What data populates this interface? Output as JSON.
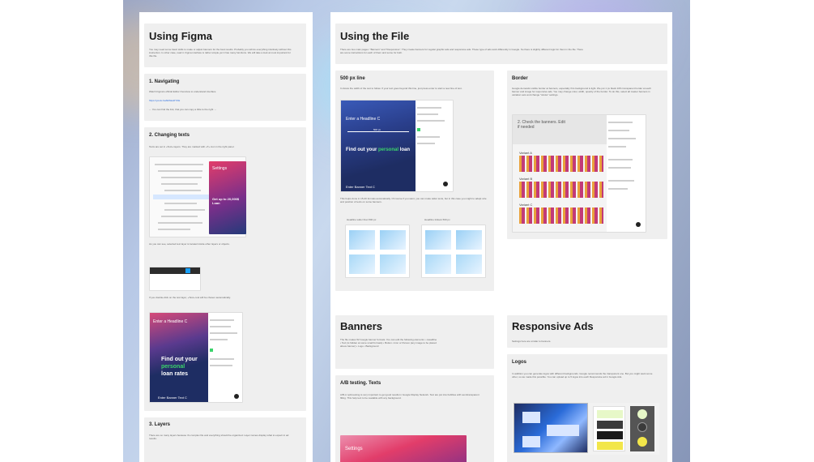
{
  "left_page": {
    "title": "Using Figma",
    "intro": "You may need some basic skills to make or adjust banners for the best results. Probably you will do everything intuitively without this instruction. In other case, read it. Figma interface is rather simple yet it has many functions. We will take a look at most important for this file.",
    "sections": {
      "navigating": {
        "heading": "1. Navigating",
        "text": "Watch Figma's official Editor Overview to understand interface",
        "link": "https://youtu.be/Eb6aw0YKE",
        "note": "← You can find the link, that you can copy a little to the right →"
      },
      "changing_texts": {
        "heading": "2. Changing texts",
        "text1": "Texts are set in «Text» layers. They are marked with «T» icon in the right panel.",
        "text2": "As you can see, selected text layer is located inside other layers or objects.",
        "text3": "If you double-click on the text layer, «Text» tool will be chosen automatically.",
        "panel_title": "Settings",
        "panel_banner_title": "Get up to 20,000$ Loan",
        "banner_headline": "Enter a Headline C",
        "banner_body_1": "Find out your",
        "banner_body_2": "personal",
        "banner_body_3": "loan rates",
        "banner_footer": "Enter Banner Text C"
      },
      "layers": {
        "heading": "3. Layers",
        "text": "There are so many layers because it's complex file and everything should be organized. Layer names display what to expect in ad results."
      }
    }
  },
  "right_page": {
    "title": "Using the File",
    "intro": "There are two main pages: \"Banners\" and \"Responsive\". They create banners for regular graphic ads and responsive ads. These type of ads work differently in Google. So there is slightly different logic for them in the file. There are some instructions for each of them and some for both.",
    "line_card": {
      "heading": "500 px line",
      "text": "It shows the width of the text to follow. If your text goes beyond this line, just press enter to start a new line of text.",
      "banner_headline": "Enter a Headline C",
      "banner_marker": "500 px",
      "banner_body_1": "Find out your",
      "banner_body_2": "personal",
      "banner_body_3": "loan",
      "banner_footer": "Enter Banner Text C",
      "caption": "This helps done in 15-20 formats automatically. Of course if you want, you can make wider texts, but in this case you might to adapt size and position of texts on some banners.",
      "label_left": "Headline wider than 500 px",
      "label_right": "Headline follows 500 px"
    },
    "border_card": {
      "heading": "Border",
      "text": "Google demands visible border at banners, especially if its background is light. We put 1 px black 10% transparent border at each banner and image for responsive ads. You may change color, width, opacity of the border. To do this, select all master banners in variation sets and change \"stroke\" settings.",
      "tooltip": "2. Check the banners. Edit if needed",
      "variant_a": "Variant A",
      "variant_b": "Variant B",
      "variant_c": "Variant C"
    },
    "banners_card": {
      "heading": "Banners",
      "text": "The file makes 52 Google banner formats. You can edit the following elements: • Headline • Text (is hidden at some small formats) • Button • Icon or Person (any image to be placed above banner) • Logo • Background"
    },
    "responsive_card": {
      "heading": "Responsive Ads",
      "text": "Settings here are similar to banners."
    },
    "ab_card": {
      "heading": "A/B testing. Texts",
      "text": "A/B or split-testing is very important to get good results in Google Display Network. Text are put into bubbles with semitransparent filling. This help text to be readable with any background.",
      "panel_title": "Settings"
    },
    "logos_card": {
      "heading": "Logos",
      "text": "In addition you can generate logos with different backgrounds. Google recommends the transparent one. But you might want some other, so we made this possible. You can upload up to 5 logos into each Responsive ad in Google Ads."
    }
  },
  "colors": {
    "banner_dark": "#1e2d63",
    "banner_accent": "#3bd36b",
    "banner_pink": "#e63a6a",
    "banner_blue": "#2a3f8c",
    "card_bg": "#efefef"
  }
}
